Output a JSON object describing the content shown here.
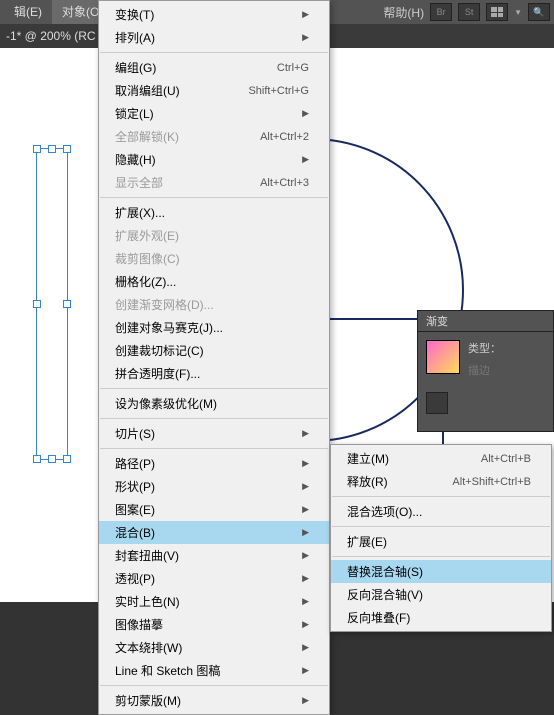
{
  "topbar": {
    "menus": [
      "辑(E)",
      "对象(O)"
    ],
    "help": "帮助(H)",
    "icons": [
      "Br",
      "St"
    ]
  },
  "tab": {
    "title": "-1* @ 200% (RC",
    "close": "×"
  },
  "panel": {
    "title": "渐变",
    "type_label": "类型：",
    "extra_label": "描边"
  },
  "menu_main": [
    {
      "l": "变换(T)",
      "sub": true
    },
    {
      "l": "排列(A)",
      "sub": true
    },
    {
      "sep": true
    },
    {
      "l": "编组(G)",
      "sc": "Ctrl+G"
    },
    {
      "l": "取消编组(U)",
      "sc": "Shift+Ctrl+G"
    },
    {
      "l": "锁定(L)",
      "sub": true
    },
    {
      "l": "全部解锁(K)",
      "sc": "Alt+Ctrl+2",
      "dis": true
    },
    {
      "l": "隐藏(H)",
      "sub": true
    },
    {
      "l": "显示全部",
      "sc": "Alt+Ctrl+3",
      "dis": true
    },
    {
      "sep": true
    },
    {
      "l": "扩展(X)..."
    },
    {
      "l": "扩展外观(E)",
      "dis": true
    },
    {
      "l": "裁剪图像(C)",
      "dis": true
    },
    {
      "l": "栅格化(Z)..."
    },
    {
      "l": "创建渐变网格(D)...",
      "dis": true
    },
    {
      "l": "创建对象马赛克(J)..."
    },
    {
      "l": "创建裁切标记(C)"
    },
    {
      "l": "拼合透明度(F)..."
    },
    {
      "sep": true
    },
    {
      "l": "设为像素级优化(M)"
    },
    {
      "sep": true
    },
    {
      "l": "切片(S)",
      "sub": true
    },
    {
      "sep": true
    },
    {
      "l": "路径(P)",
      "sub": true
    },
    {
      "l": "形状(P)",
      "sub": true
    },
    {
      "l": "图案(E)",
      "sub": true
    },
    {
      "l": "混合(B)",
      "sub": true,
      "hi": true
    },
    {
      "l": "封套扭曲(V)",
      "sub": true
    },
    {
      "l": "透视(P)",
      "sub": true
    },
    {
      "l": "实时上色(N)",
      "sub": true
    },
    {
      "l": "图像描摹",
      "sub": true
    },
    {
      "l": "文本绕排(W)",
      "sub": true
    },
    {
      "l": "Line 和 Sketch 图稿",
      "sub": true
    },
    {
      "sep": true
    },
    {
      "l": "剪切蒙版(M)",
      "sub": true
    }
  ],
  "menu_sub": [
    {
      "l": "建立(M)",
      "sc": "Alt+Ctrl+B"
    },
    {
      "l": "释放(R)",
      "sc": "Alt+Shift+Ctrl+B"
    },
    {
      "sep": true
    },
    {
      "l": "混合选项(O)..."
    },
    {
      "sep": true
    },
    {
      "l": "扩展(E)"
    },
    {
      "sep": true
    },
    {
      "l": "替换混合轴(S)",
      "hi": true
    },
    {
      "l": "反向混合轴(V)"
    },
    {
      "l": "反向堆叠(F)"
    }
  ]
}
